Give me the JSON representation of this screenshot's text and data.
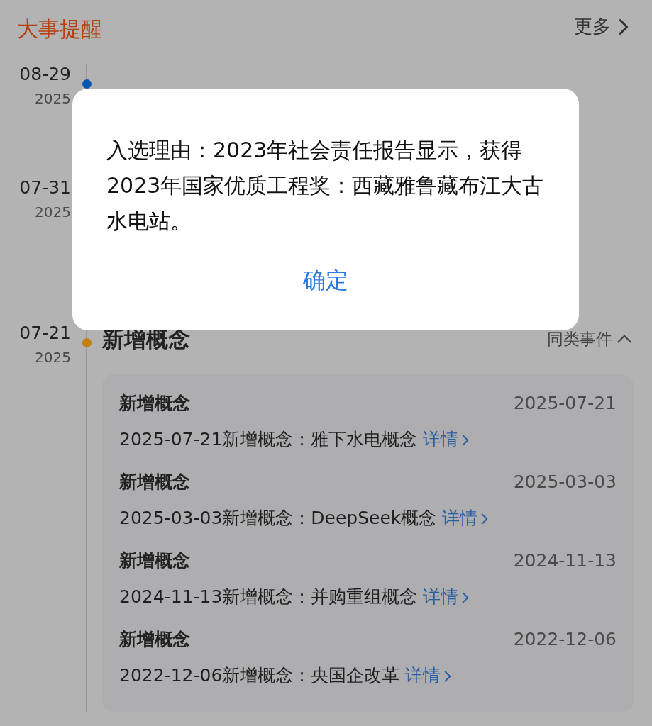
{
  "header": {
    "title": "大事提醒",
    "more": "更多"
  },
  "timeline": [
    {
      "date": "08-29",
      "year": "2025",
      "color": "#0a55b0"
    },
    {
      "date": "07-31",
      "year": "2025"
    },
    {
      "date": "07-21",
      "year": "2025",
      "color": "#c47f0c",
      "title": "新增概念",
      "related": "同类事件",
      "expanded": true,
      "items": [
        {
          "title": "新增概念",
          "date": "2025-07-21",
          "text": "2025-07-21新增概念：雅下水电概念",
          "link": "详情"
        },
        {
          "title": "新增概念",
          "date": "2025-03-03",
          "text": "2025-03-03新增概念：DeepSeek概念",
          "link": "详情"
        },
        {
          "title": "新增概念",
          "date": "2024-11-13",
          "text": "2024-11-13新增概念：并购重组概念",
          "link": "详情"
        },
        {
          "title": "新增概念",
          "date": "2022-12-06",
          "text": "2022-12-06新增概念：央国企改革",
          "link": "详情"
        }
      ]
    }
  ],
  "dialog": {
    "message": "入选理由：2023年社会责任报告显示，获得2023年国家优质工程奖：西藏雅鲁藏布江大古水电站。",
    "button": "确定"
  }
}
